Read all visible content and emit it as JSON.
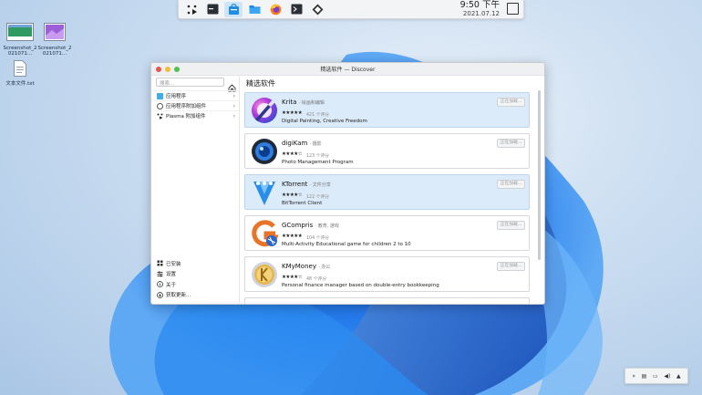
{
  "top_panel": {
    "time": "9:50 下午",
    "date": "2021.07.12"
  },
  "desktop": {
    "icons": [
      {
        "label": "Screenshot_2021071...",
        "icon": "screenshot-image-icon"
      },
      {
        "label": "Screenshot_2021071...",
        "icon": "screenshot-image-icon"
      },
      {
        "label": "文本文件.txt",
        "icon": "text-file-icon"
      }
    ]
  },
  "window": {
    "title": "精选软件 — Discover",
    "search_placeholder": "搜索...",
    "sidebar": {
      "items": [
        {
          "label": "应用程序",
          "icon": "applications-icon"
        },
        {
          "label": "应用程序附加组件",
          "icon": "addons-icon"
        },
        {
          "label": "Plasma 附加组件",
          "icon": "plasma-icon"
        }
      ],
      "bottom_items": [
        {
          "label": "已安装",
          "icon": "installed-icon"
        },
        {
          "label": "设置",
          "icon": "settings-icon"
        },
        {
          "label": "关于",
          "icon": "about-icon"
        },
        {
          "label": "获取更新...",
          "icon": "update-icon"
        }
      ]
    },
    "main_title": "精选软件",
    "apps": [
      {
        "name": "Krita",
        "category": "· 绘画和编辑",
        "rating": "421 个评分",
        "description": "Digital Painting, Creative Freedom",
        "button": "正在加载...",
        "highlighted": true
      },
      {
        "name": "digiKam",
        "category": "· 摄影",
        "rating": "123 个评分",
        "description": "Photo Management Program",
        "button": "正在加载...",
        "highlighted": false
      },
      {
        "name": "KTorrent",
        "category": "· 文件分享",
        "rating": "122 个评分",
        "description": "BitTorrent Client",
        "button": "正在加载...",
        "highlighted": true
      },
      {
        "name": "GCompris",
        "category": "· 教育, 游戏",
        "rating": "104 个评分",
        "description": "Multi-Activity Educational game for children 2 to 10",
        "button": "正在加载...",
        "highlighted": false
      },
      {
        "name": "KMyMoney",
        "category": "· 办公",
        "rating": "48 个评分",
        "description": "Personal finance manager based on double-entry bookkeeping",
        "button": "正在加载...",
        "highlighted": false
      }
    ]
  },
  "colors": {
    "accent": "#3daee9",
    "highlight_card": "#dcebfa",
    "close": "#e8574f",
    "minimize": "#f5bc3a",
    "maximize": "#53c250"
  }
}
